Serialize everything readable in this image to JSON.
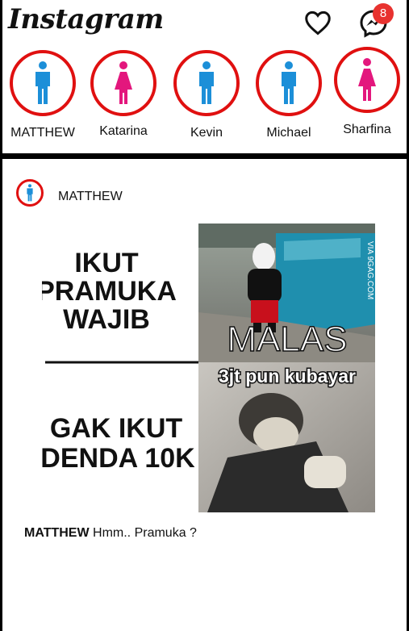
{
  "header": {
    "logo_text": "Instagram",
    "heart_icon": "heart-outline-icon",
    "messenger_icon": "messenger-icon",
    "message_badge": "8"
  },
  "stories": [
    {
      "name": "MATTHEW",
      "gender": "male"
    },
    {
      "name": "Katarina",
      "gender": "female"
    },
    {
      "name": "Kevin",
      "gender": "male"
    },
    {
      "name": "Michael",
      "gender": "male"
    },
    {
      "name": "Sharfina",
      "gender": "female"
    }
  ],
  "post": {
    "username": "MATTHEW",
    "meme": {
      "left_top_text": [
        "IKUT",
        "PRAMUKA",
        "WAJIB"
      ],
      "left_bottom_text": [
        "GAK IKUT",
        "DENDA 10K"
      ],
      "right_top_text": "MALAS",
      "right_middle_text": "3jt pun kubayar",
      "watermark": "VIA 9GAG.COM"
    },
    "caption_user": "MATTHEW",
    "caption_text": " Hmm.. Pramuka ?"
  },
  "colors": {
    "ring": "#e01010",
    "male_icon": "#1c8fd8",
    "female_icon": "#e3177d",
    "badge": "#e8322f"
  }
}
